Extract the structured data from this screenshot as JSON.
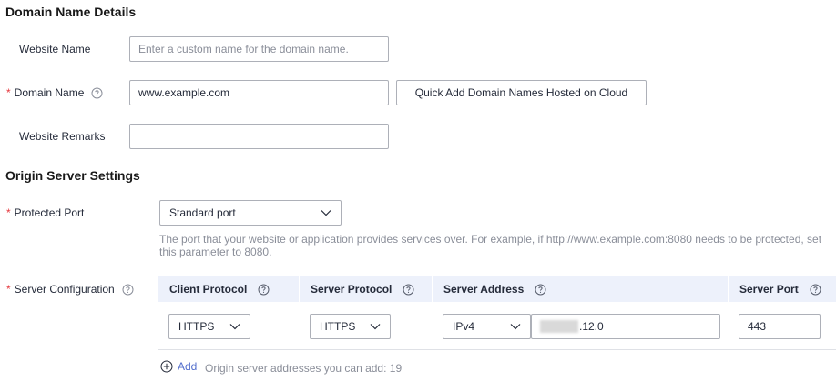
{
  "sections": {
    "domain_details": "Domain Name Details",
    "origin_settings": "Origin Server Settings"
  },
  "website_name": {
    "label": "Website Name",
    "value": "",
    "placeholder": "Enter a custom name for the domain name."
  },
  "domain_name": {
    "required_mark": "*",
    "label": "Domain Name",
    "value": "www.example.com",
    "quick_add_button": "Quick Add Domain Names Hosted on Cloud"
  },
  "website_remarks": {
    "label": "Website Remarks",
    "value": ""
  },
  "protected_port": {
    "required_mark": "*",
    "label": "Protected Port",
    "selected": "Standard port",
    "hint": "The port that your website or application provides services over. For example, if http://www.example.com:8080 needs to be protected, set this parameter to 8080."
  },
  "server_configuration": {
    "required_mark": "*",
    "label": "Server Configuration",
    "columns": {
      "client_protocol": "Client Protocol",
      "server_protocol": "Server Protocol",
      "server_address": "Server Address",
      "server_port": "Server Port"
    },
    "row": {
      "client_protocol": "HTTPS",
      "server_protocol": "HTTPS",
      "address_type": "IPv4",
      "address_visible_suffix": ".12.0",
      "server_port": "443"
    },
    "add_label": "Add",
    "add_hint": "Origin server addresses you can add: 19"
  },
  "colors": {
    "required": "#e6383e",
    "link": "#526ecc",
    "table_header_bg": "#edf1fb",
    "border": "#adb0b8",
    "hint_text": "#8a8e99"
  }
}
